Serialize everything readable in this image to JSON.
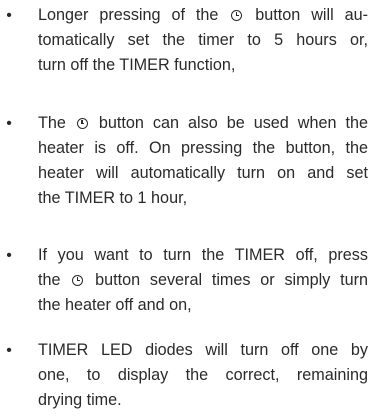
{
  "bullet_glyph": "•",
  "icons": {
    "timer": "clock-icon"
  },
  "items": [
    {
      "l1a": "Longer pressing of the",
      "l1b": "button will au-",
      "l2": "tomatically set the timer to 5 hours or,",
      "l3": "turn off the TIMER function,"
    },
    {
      "l1a": "The",
      "l1b": "button can also be used when the",
      "l2": "heater is off. On pressing the button, the",
      "l3": "heater will automatically turn on and set",
      "l4": "the TIMER to 1 hour,"
    },
    {
      "l1": "If you want to turn the TIMER off, press",
      "l2a": "the",
      "l2b": "button several times or simply turn",
      "l3": "the heater off and on,"
    },
    {
      "l1": "TIMER LED diodes will turn off one by",
      "l2": "one, to display the correct, remaining",
      "l3": "drying time."
    }
  ]
}
